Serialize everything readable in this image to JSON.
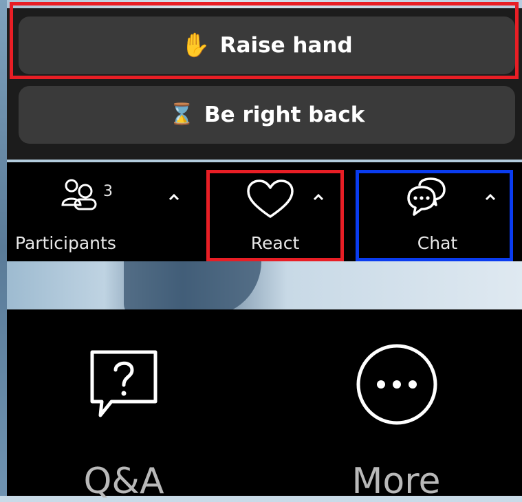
{
  "popup": {
    "raise_hand": {
      "emoji": "✋",
      "label": "Raise hand"
    },
    "be_right_back": {
      "emoji": "⌛",
      "label": "Be right back"
    }
  },
  "toolbar": {
    "participants": {
      "label": "Participants",
      "count": "3"
    },
    "react": {
      "label": "React"
    },
    "chat": {
      "label": "Chat"
    }
  },
  "bottombar": {
    "qa": {
      "label": "Q&A"
    },
    "more": {
      "label": "More"
    }
  },
  "icons": {
    "raise_hand": "raised-hand-icon",
    "be_right_back": "hourglass-icon",
    "participants": "people-icon",
    "react": "heart-icon",
    "chat": "chat-bubbles-icon",
    "qa": "question-bubble-icon",
    "more": "more-dots-icon",
    "caret": "chevron-up-icon"
  },
  "colors": {
    "highlight_red": "#e81e25",
    "highlight_blue": "#0a3cf0",
    "pill_bg": "#3a3a3a",
    "toolbar_bg": "#000000",
    "hand_emoji": "#f6b73c"
  }
}
